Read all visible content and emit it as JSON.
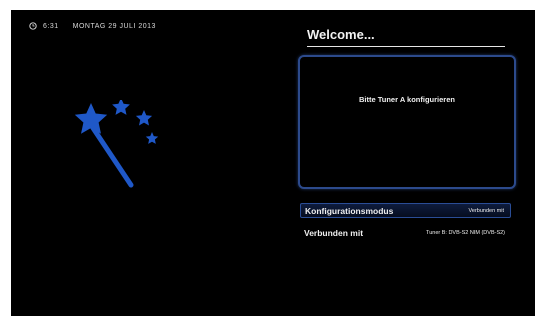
{
  "statusbar": {
    "clock_icon": "clock-icon",
    "time": "6:31",
    "date": "MONTAG 29 JULI 2013"
  },
  "wizard": {
    "icon": "magic-wand-stars-icon",
    "accent_color": "#1f58c8"
  },
  "title": "Welcome...",
  "info_panel": {
    "message": "Bitte Tuner A konfigurieren"
  },
  "settings": {
    "rows": [
      {
        "label": "Konfigurationsmodus",
        "value": "Verbunden mit"
      },
      {
        "label": "Verbunden mit",
        "value": "Tuner B: DVB-S2 NIM (DVB-S2)"
      }
    ]
  },
  "colors": {
    "background": "#000000",
    "panel_border": "#2c4a8c",
    "selection": "#0e1c3d"
  }
}
